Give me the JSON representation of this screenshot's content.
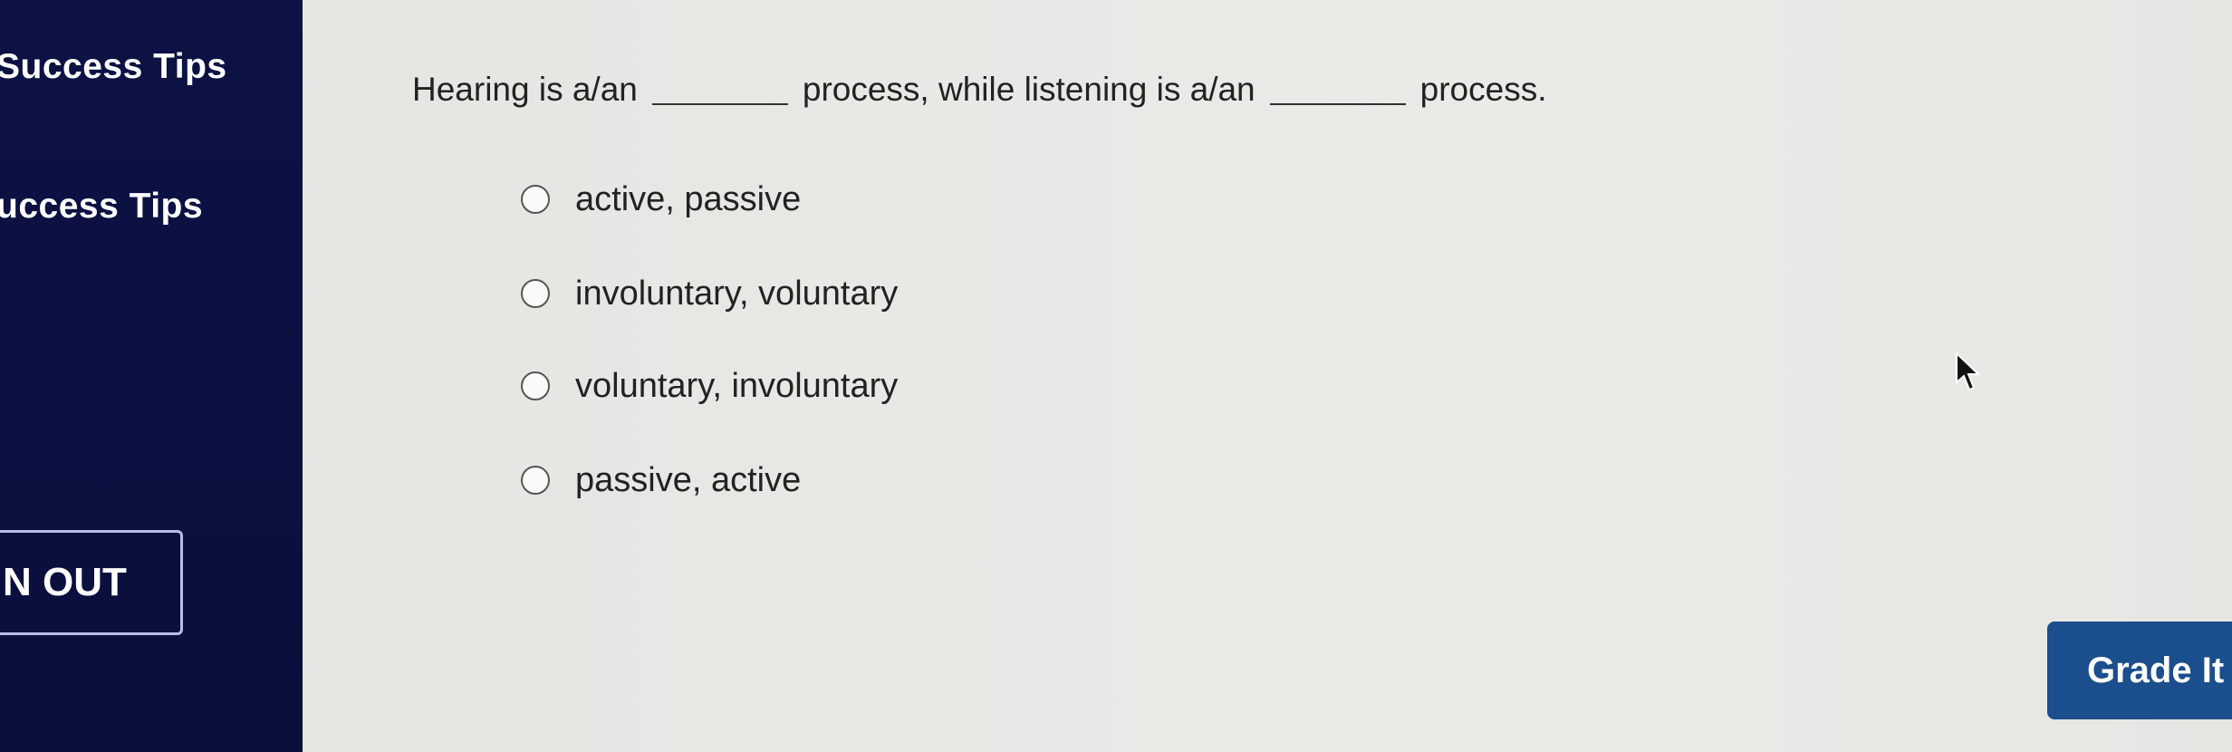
{
  "sidebar": {
    "links": [
      {
        "label": "Success Tips"
      },
      {
        "label": "uccess Tips"
      }
    ],
    "signout_label": "N OUT"
  },
  "question": {
    "part1": "Hearing is a/an",
    "part2": "process, while listening is a/an",
    "part3": "process."
  },
  "options": [
    {
      "label": "active, passive",
      "selected": false
    },
    {
      "label": "involuntary, voluntary",
      "selected": false
    },
    {
      "label": "voluntary, involuntary",
      "selected": false
    },
    {
      "label": "passive, active",
      "selected": false
    }
  ],
  "grade_button": {
    "label": "Grade It"
  },
  "colors": {
    "sidebar": "#0b1040",
    "grade_button": "#1a4e8c",
    "background": "#e8e8e5"
  },
  "icons": {
    "cursor": "mouse-pointer-icon"
  }
}
